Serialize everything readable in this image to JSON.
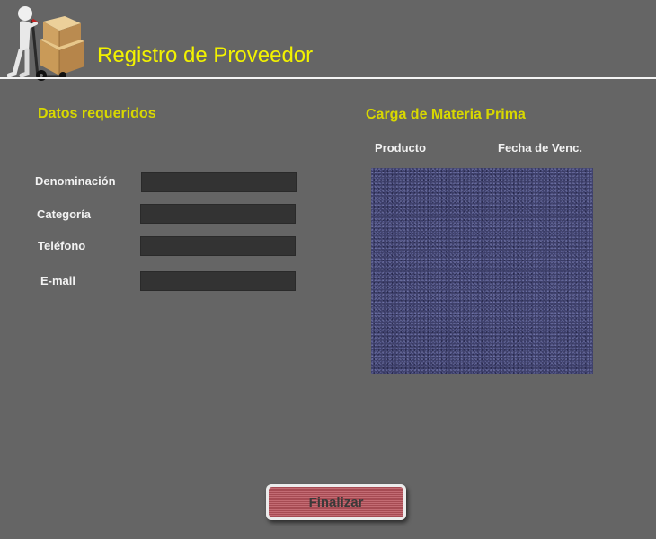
{
  "header": {
    "title": "Registro de Proveedor",
    "logo_icon": "stick-figure-hand-truck-boxes-icon"
  },
  "left_section": {
    "title": "Datos requeridos",
    "fields": [
      {
        "label": "Denominación",
        "value": ""
      },
      {
        "label": "Categoría",
        "value": ""
      },
      {
        "label": "Teléfono",
        "value": ""
      },
      {
        "label": "E-mail",
        "value": ""
      }
    ]
  },
  "right_section": {
    "title": "Carga de Materia Prima",
    "columns": [
      "Producto",
      "Fecha de Venc."
    ],
    "rows": []
  },
  "footer": {
    "finalize_label": "Finalizar"
  },
  "colors": {
    "background": "#656565",
    "accent_yellow": "#f2f200",
    "input_bg": "#333333",
    "list_bg": "#3d3f6b",
    "button_red": "#b85a62"
  }
}
